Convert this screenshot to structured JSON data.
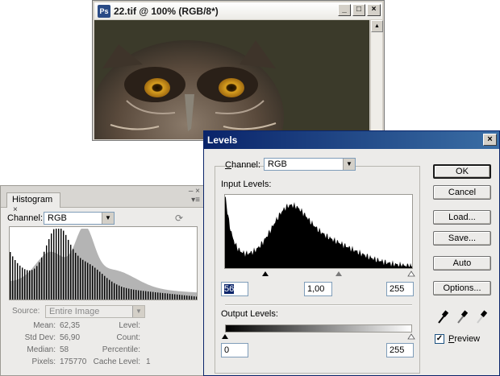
{
  "document_window": {
    "title": "22.tif @ 100% (RGB/8*)",
    "app_icon": "photoshop-icon",
    "controls": [
      "minimize-icon",
      "restore-icon",
      "close-icon"
    ]
  },
  "histogram_panel": {
    "tab_label": "Histogram",
    "tab_close": "×",
    "panel_controls": [
      "–",
      "×",
      "▾≡"
    ],
    "channel_label": "Channel:",
    "channel_value": "RGB",
    "source_label": "Source:",
    "source_value": "Entire Image",
    "stats": {
      "mean_label": "Mean:",
      "mean": "62,35",
      "std_dev_label": "Std Dev:",
      "std_dev": "56,90",
      "median_label": "Median:",
      "median": "58",
      "pixels_label": "Pixels:",
      "pixels": "175770",
      "level_label": "Level:",
      "level": "",
      "count_label": "Count:",
      "count": "",
      "percentile_label": "Percentile:",
      "percentile": "",
      "cache_level_label": "Cache Level:",
      "cache_level": "1"
    }
  },
  "levels_dialog": {
    "title": "Levels",
    "channel_label": "Channel:",
    "channel_value": "RGB",
    "input_levels_label": "Input Levels:",
    "input_black": "56",
    "input_gamma": "1,00",
    "input_white": "255",
    "output_levels_label": "Output Levels:",
    "output_black": "0",
    "output_white": "255",
    "buttons": {
      "ok": "OK",
      "cancel": "Cancel",
      "load": "Load...",
      "save": "Save...",
      "auto": "Auto",
      "options": "Options..."
    },
    "eyedroppers": [
      "black-point-eyedropper-icon",
      "gray-point-eyedropper-icon",
      "white-point-eyedropper-icon"
    ],
    "preview_label": "Preview",
    "preview_checked": true
  },
  "colors": {
    "dialog_title_start": "#0a246a",
    "dialog_title_end": "#3a6ea5",
    "panel_bg": "#ecebe9"
  }
}
